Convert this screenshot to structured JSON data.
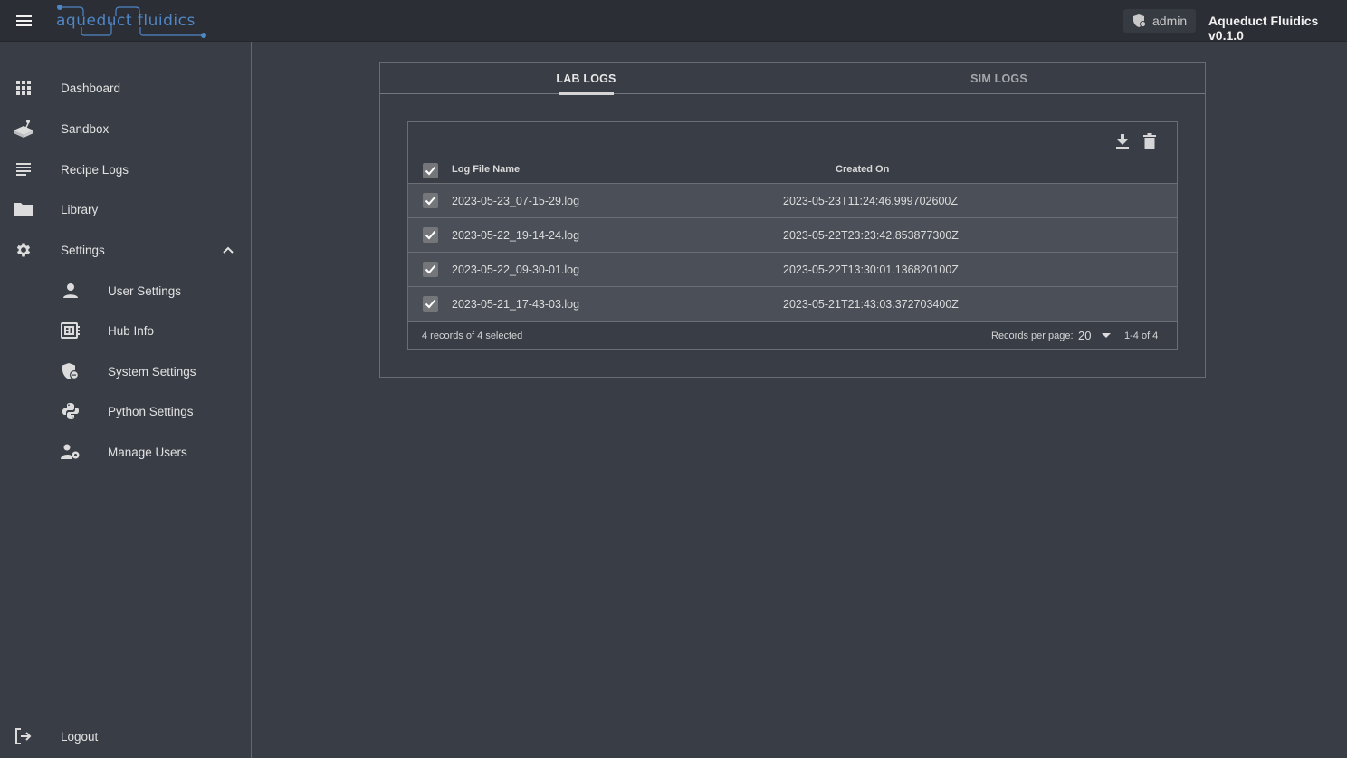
{
  "header": {
    "logo_text": "aqueduct fluidics",
    "user_label": "admin",
    "app_version": "Aqueduct Fluidics v0.1.0",
    "accent_color": "#4f86c6"
  },
  "sidebar": {
    "items": [
      {
        "label": "Dashboard",
        "icon": "grid-icon"
      },
      {
        "label": "Sandbox",
        "icon": "joystick-icon"
      },
      {
        "label": "Recipe Logs",
        "icon": "notes-icon"
      },
      {
        "label": "Library",
        "icon": "folder-icon"
      },
      {
        "label": "Settings",
        "icon": "gear-icon",
        "expanded": true
      }
    ],
    "settings_children": [
      {
        "label": "User Settings",
        "icon": "person-icon"
      },
      {
        "label": "Hub Info",
        "icon": "chip-icon"
      },
      {
        "label": "System Settings",
        "icon": "shield-icon"
      },
      {
        "label": "Python Settings",
        "icon": "python-icon"
      },
      {
        "label": "Manage Users",
        "icon": "user-gear-icon"
      }
    ],
    "logout_label": "Logout"
  },
  "main": {
    "tabs": [
      {
        "label": "LAB LOGS",
        "active": true
      },
      {
        "label": "SIM LOGS",
        "active": false
      }
    ],
    "table": {
      "columns": [
        "Log File Name",
        "Created On"
      ],
      "header_checked": true,
      "rows": [
        {
          "name": "2023-05-23_07-15-29.log",
          "created": "2023-05-23T11:24:46.999702600Z",
          "checked": true
        },
        {
          "name": "2023-05-22_19-14-24.log",
          "created": "2023-05-22T23:23:42.853877300Z",
          "checked": true
        },
        {
          "name": "2023-05-22_09-30-01.log",
          "created": "2023-05-22T13:30:01.136820100Z",
          "checked": true
        },
        {
          "name": "2023-05-21_17-43-03.log",
          "created": "2023-05-21T21:43:03.372703400Z",
          "checked": true
        }
      ],
      "selection_text": "4 records of 4 selected",
      "records_per_page_label": "Records per page:",
      "records_per_page_value": "20",
      "range_text": "1-4 of 4"
    }
  }
}
